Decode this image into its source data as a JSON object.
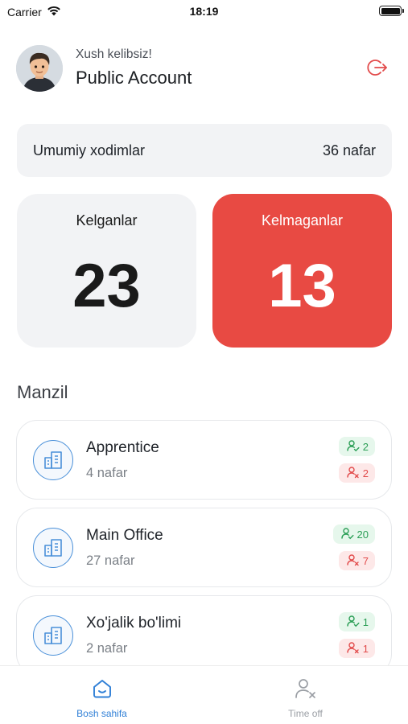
{
  "status_bar": {
    "carrier": "Carrier",
    "time": "18:19"
  },
  "header": {
    "greeting": "Xush kelibsiz!",
    "account_name": "Public Account",
    "logout_icon": "logout-icon"
  },
  "summary": {
    "total_label": "Umumiy xodimlar",
    "total_value": "36 nafar",
    "came_label": "Kelganlar",
    "came_value": "23",
    "absent_label": "Kelmaganlar",
    "absent_value": "13"
  },
  "locations": {
    "title": "Manzil",
    "items": [
      {
        "name": "Apprentice",
        "count": "4 nafar",
        "present": "2",
        "absent": "2"
      },
      {
        "name": "Main Office",
        "count": "27 nafar",
        "present": "20",
        "absent": "7"
      },
      {
        "name": "Xo'jalik bo'limi",
        "count": "2 nafar",
        "present": "1",
        "absent": "1"
      }
    ]
  },
  "tab_bar": {
    "tabs": [
      {
        "label": "Bosh sahifa",
        "icon": "home-icon",
        "active": true
      },
      {
        "label": "Time off",
        "icon": "user-x-icon",
        "active": false
      }
    ]
  },
  "colors": {
    "accent": "#2f7fd6",
    "danger": "#e84a43",
    "success": "#2b9e56",
    "card_bg": "#f2f3f5"
  }
}
